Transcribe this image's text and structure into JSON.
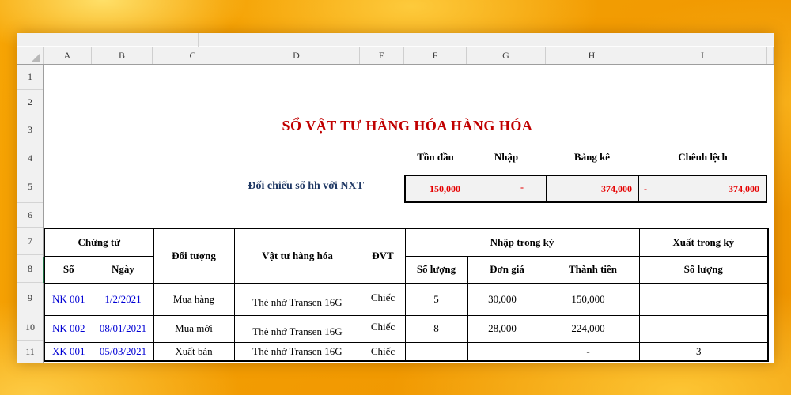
{
  "sheet": {
    "column_letters": [
      "A",
      "B",
      "C",
      "D",
      "E",
      "F",
      "G",
      "H",
      "I"
    ],
    "row_numbers": [
      "1",
      "2",
      "3",
      "4",
      "5",
      "6",
      "7",
      "8",
      "9",
      "10",
      "11"
    ],
    "title": "SỔ VẬT TƯ HÀNG HÓA HÀNG HÓA",
    "reconcile_label": "Đối chiếu sổ hh với NXT",
    "summary": {
      "headers": {
        "ton_dau": "Tồn đầu",
        "nhap": "Nhập",
        "bang_ke": "Bảng kê",
        "chenh_lech": "Chênh lệch"
      },
      "values": {
        "ton_dau": "150,000",
        "nhap": "-",
        "bang_ke": "374,000",
        "chenh_lech_sign": "-",
        "chenh_lech": "374,000"
      }
    },
    "table": {
      "headers": {
        "chung_tu": "Chứng từ",
        "so": "Số",
        "ngay": "Ngày",
        "doi_tuong": "Đối tượng",
        "vat_tu": "Vật tư hàng hóa",
        "dvt": "ĐVT",
        "nhap_trong_ky": "Nhập trong kỳ",
        "so_luong_nhap": "Số lượng",
        "don_gia": "Đơn giá",
        "thanh_tien": "Thành tiền",
        "xuat_trong_ky": "Xuất trong kỳ",
        "so_luong_xuat": "Số lượng"
      },
      "rows": [
        {
          "so": "NK 001",
          "ngay": "1/2/2021",
          "doi_tuong": "Mua hàng",
          "vat_tu": "Thẻ nhớ Transen 16G",
          "dvt": "Chiếc",
          "sl_nhap": "5",
          "don_gia": "30,000",
          "thanh_tien": "150,000",
          "sl_xuat": ""
        },
        {
          "so": "NK 002",
          "ngay": "08/01/2021",
          "doi_tuong": "Mua mới",
          "vat_tu": "Thẻ nhớ Transen 16G",
          "dvt": "Chiếc",
          "sl_nhap": "8",
          "don_gia": "28,000",
          "thanh_tien": "224,000",
          "sl_xuat": ""
        },
        {
          "so": "XK 001",
          "ngay": "05/03/2021",
          "doi_tuong": "Xuất bán",
          "vat_tu": "Thẻ nhớ Transen 16G",
          "dvt": "Chiếc",
          "sl_nhap": "",
          "don_gia": "",
          "thanh_tien": "-",
          "sl_xuat": "3"
        }
      ]
    },
    "colors": {
      "title_red": "#C00000",
      "value_red": "#E60000",
      "link_blue": "#0000D4",
      "label_navy": "#1F3864",
      "active_cell_green": "#217346",
      "background_orange": "#F59E00"
    }
  }
}
